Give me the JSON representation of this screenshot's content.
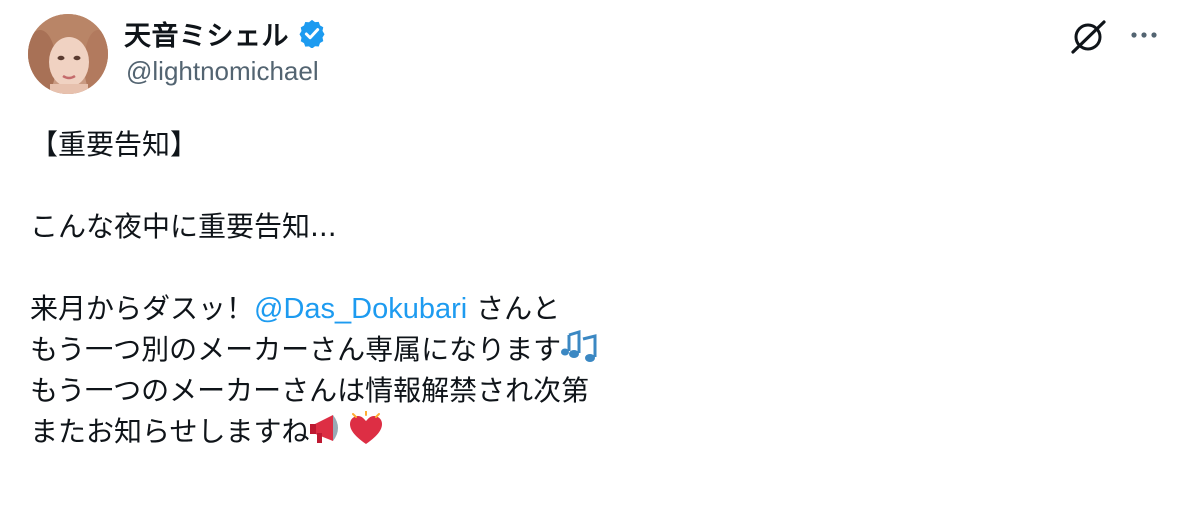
{
  "author": {
    "display_name": "天音ミシェル",
    "handle": "@lightnomichael"
  },
  "tweet": {
    "line1": "【重要告知】",
    "line2": "こんな夜中に重要告知...",
    "line3_before": "来月からダスッ！",
    "mention": "@Das_Dokubari",
    "line3_after": " さんと",
    "line4": "もう一つ別のメーカーさん専属になります",
    "line5": "もう一つのメーカーさんは情報解禁され次第",
    "line6": "またお知らせしますね"
  },
  "icons": {
    "verified": "verified-badge-icon",
    "grok": "grok-icon",
    "more": "more-options-icon",
    "music": "musical-notes-icon",
    "megaphone": "megaphone-icon",
    "heart": "beating-heart-icon"
  },
  "colors": {
    "link": "#1d9bf0",
    "verified": "#1d9bf0",
    "secondary_text": "#536471"
  }
}
